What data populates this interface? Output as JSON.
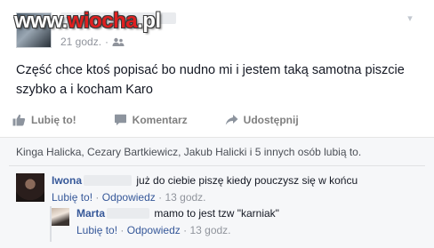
{
  "watermark": {
    "prefix": "www.",
    "brand": "wiocha",
    "suffix": ".pl"
  },
  "post": {
    "timestamp": "21 godz.",
    "separator": "·",
    "audience_icon": "friends-icon",
    "text_line1": "Część chce ktoś popisać bo nudno mi i jestem taką samotna piszcie",
    "text_line2": "szybko a i kocham Karo"
  },
  "actions": {
    "like_label": "Lubię to!",
    "comment_label": "Komentarz",
    "share_label": "Udostępnij"
  },
  "likes": {
    "text": "Kinga Halicka, Cezary Bartkiewicz, Jakub Halicki i 5 innych osób lubią to."
  },
  "comments": [
    {
      "author": "Iwona",
      "text": "już do ciebie piszę kiedy pouczysz się w końcu",
      "like_label": "Lubię to!",
      "reply_label": "Odpowiedz",
      "time": "13 godz."
    }
  ],
  "replies": [
    {
      "author": "Marta",
      "text": "mamo to jest tzw \"karniak\"",
      "like_label": "Lubię to!",
      "reply_label": "Odpowiedz",
      "time": "13 godz."
    }
  ],
  "colors": {
    "link": "#365899",
    "meta": "#90949c",
    "action": "#7f7f7f",
    "watermark_accent": "#e02020"
  }
}
